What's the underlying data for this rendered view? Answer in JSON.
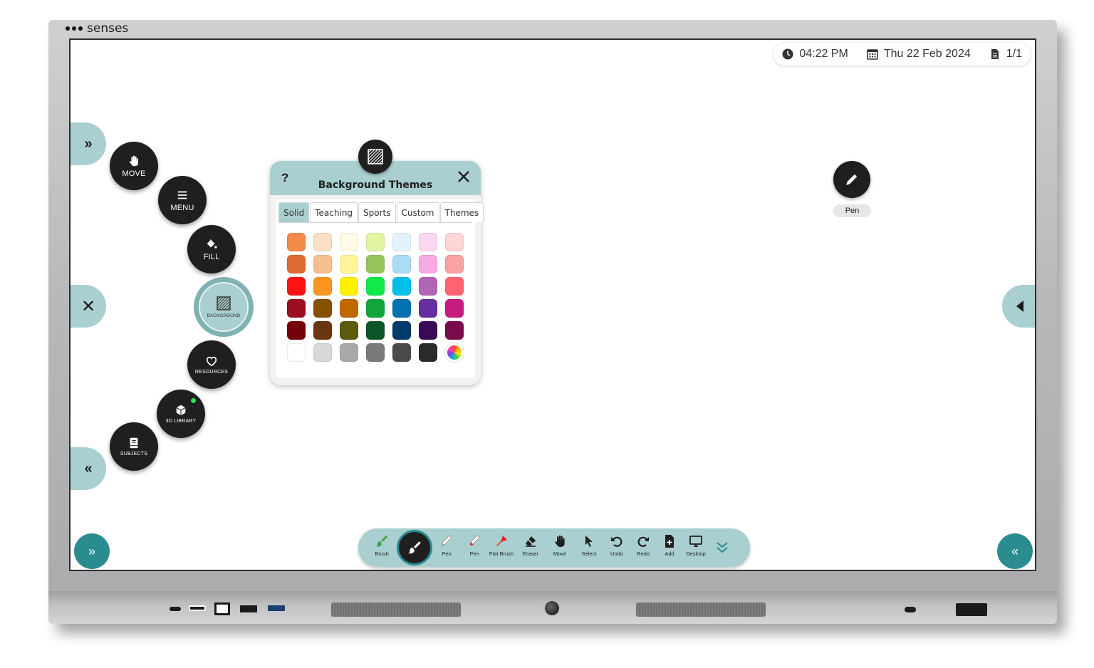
{
  "brand": {
    "name": "senses"
  },
  "status": {
    "time": "04:22 PM",
    "date": "Thu 22 Feb 2024",
    "pages": "1/1"
  },
  "radial_menu": {
    "move": "MOVE",
    "menu": "MENU",
    "fill": "FILL",
    "background": "BACKGROUND",
    "resources": "RESOURCES",
    "library3d": "3D LIBRARY",
    "subjects": "SUBJECTS"
  },
  "side_tabs": {
    "expand": "»",
    "close": "✕",
    "collapse": "«"
  },
  "panel": {
    "title": "Background Themes",
    "help": "?",
    "tabs": [
      "Solid",
      "Teaching",
      "Sports",
      "Custom",
      "Themes"
    ],
    "active_tab": "Solid",
    "swatches": [
      "#f28a48",
      "#fae0c4",
      "#fffbe6",
      "#e3f5a4",
      "#e3f3fb",
      "#fbd7f1",
      "#fcd5d5",
      "#dd6a30",
      "#f9bf8d",
      "#fff49a",
      "#97c45a",
      "#aadcf5",
      "#f9a9e4",
      "#f9a1a3",
      "#ff1212",
      "#fb9622",
      "#fff000",
      "#11e84a",
      "#00c0e8",
      "#b066b3",
      "#ff6470",
      "#9b1020",
      "#875100",
      "#c06800",
      "#12a53a",
      "#0073b0",
      "#6630a0",
      "#c61c80",
      "#760009",
      "#6a3513",
      "#5c5a0e",
      "#0b5529",
      "#003b6c",
      "#3b0a57",
      "#7a0a4b",
      "#ffffff",
      "#d8d8d8",
      "#a9a9a9",
      "#7a7a7a",
      "#4a4a4a",
      "#2a2a2a",
      "picker"
    ]
  },
  "pen_float": {
    "label": "Pen"
  },
  "toolbar": {
    "items": [
      {
        "label": "Brush",
        "icon": "brush-icon",
        "color": "#3aa14a"
      },
      {
        "label": "Pen",
        "icon": "pen-icon",
        "color": "#ffffff"
      },
      {
        "label": "Pen",
        "icon": "pen-icon",
        "color": "#e5262b"
      },
      {
        "label": "Flat Brush",
        "icon": "flat-brush-icon",
        "color": "#e5262b"
      },
      {
        "label": "Eraser",
        "icon": "eraser-icon"
      },
      {
        "label": "Move",
        "icon": "hand-icon"
      },
      {
        "label": "Select",
        "icon": "cursor-icon"
      },
      {
        "label": "Undo",
        "icon": "undo-icon"
      },
      {
        "label": "Redo",
        "icon": "redo-icon"
      },
      {
        "label": "Add",
        "icon": "add-page-icon"
      },
      {
        "label": "Desktop",
        "icon": "desktop-icon"
      }
    ]
  },
  "corner_buttons": {
    "left": "»",
    "right": "«"
  },
  "colors": {
    "accent": "#2a8c8f",
    "panel_head": "#a9cfd0",
    "button_dark": "#1f1f1f"
  }
}
